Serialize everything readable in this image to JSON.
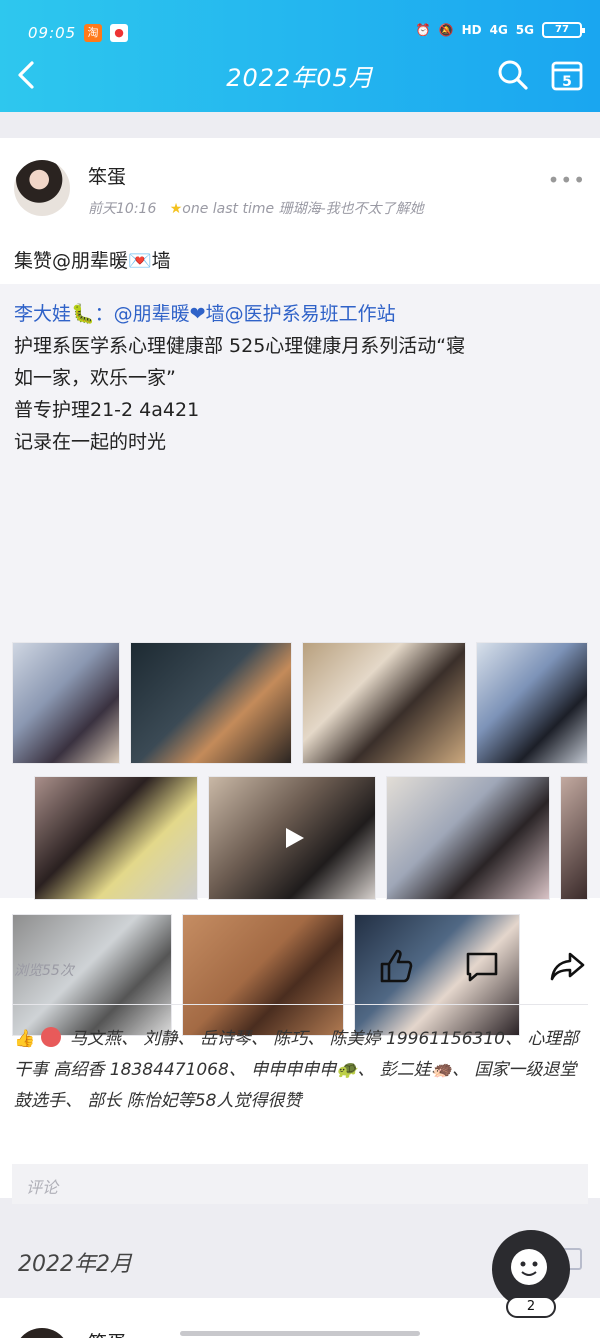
{
  "status": {
    "time": "09:05",
    "battery": "77",
    "hd": "HD",
    "net1": "4G",
    "net2": "5G"
  },
  "nav": {
    "title": "2022年05月"
  },
  "post": {
    "author": "笨蛋",
    "time": "前天10:16",
    "music": "one last time 珊瑚海-我也不太了解她",
    "repost_text": "集赞@朋辈暖💌墙",
    "quote_lines": [
      "李大娃🐛：@朋辈暖❤墙@医护系易班工作站",
      "护理系医学系心理健康部 525心理健康月系列活动“寝",
      "如一家，欢乐一家”",
      "普专护理21-2 4a421",
      "记录在一起的时光"
    ],
    "views": "浏览55次",
    "likes_text": "马文燕、 刘静、 岳诗琴、 陈巧、 陈美婷 19961156310、 心理部干事 高绍香 18384471068、 申申申申申🐢、 彭二娃🦔、 国家一级退堂鼓选手、 部长 陈怡妃等58人觉得很赞",
    "comment_placeholder": "评论"
  },
  "next": {
    "date": "2022年2月",
    "author": "笨蛋"
  },
  "float_badge": "2",
  "colors": {
    "header_start": "#2ec7ee",
    "header_end": "#1aa6f0",
    "mention": "#2f62c8"
  }
}
